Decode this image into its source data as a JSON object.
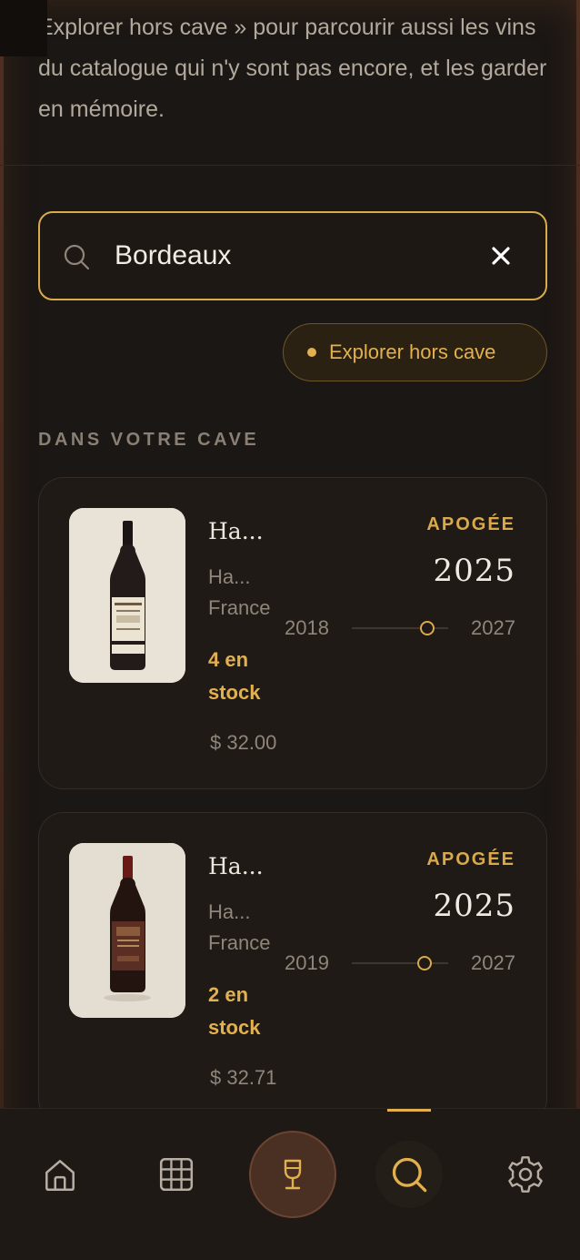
{
  "intro_text": "Explorer hors cave » pour parcourir aussi les vins du catalogue qui n'y sont pas encore, et les garder en mémoire.",
  "search": {
    "value": "Bordeaux",
    "clear_icon": "close-icon",
    "search_icon": "search-icon"
  },
  "explore_chip": {
    "label": "Explorer hors cave"
  },
  "section_title": "DANS VOTRE CAVE",
  "wines": [
    {
      "name": "Ha...",
      "region": "Ha...",
      "country": "France",
      "stock": "4 en stock",
      "price": "$ 32.00",
      "apogee_label": "APOGÉE",
      "apogee_year": "2025",
      "window_from": "2018",
      "window_to": "2027",
      "window_position": 0.78
    },
    {
      "name": "Ha...",
      "region": "Ha...",
      "country": "France",
      "stock": "2 en stock",
      "price": "$ 32.71",
      "apogee_label": "APOGÉE",
      "apogee_year": "2025",
      "window_from": "2019",
      "window_to": "2027",
      "window_position": 0.75
    }
  ],
  "nav": {
    "items": [
      {
        "icon": "home-icon"
      },
      {
        "icon": "grid-icon"
      },
      {
        "icon": "wine-glass-icon"
      },
      {
        "icon": "search-icon",
        "active": true
      },
      {
        "icon": "gear-icon"
      }
    ]
  },
  "colors": {
    "accent": "#e3b04f",
    "background": "#1b1714",
    "card": "#1f1a16"
  }
}
